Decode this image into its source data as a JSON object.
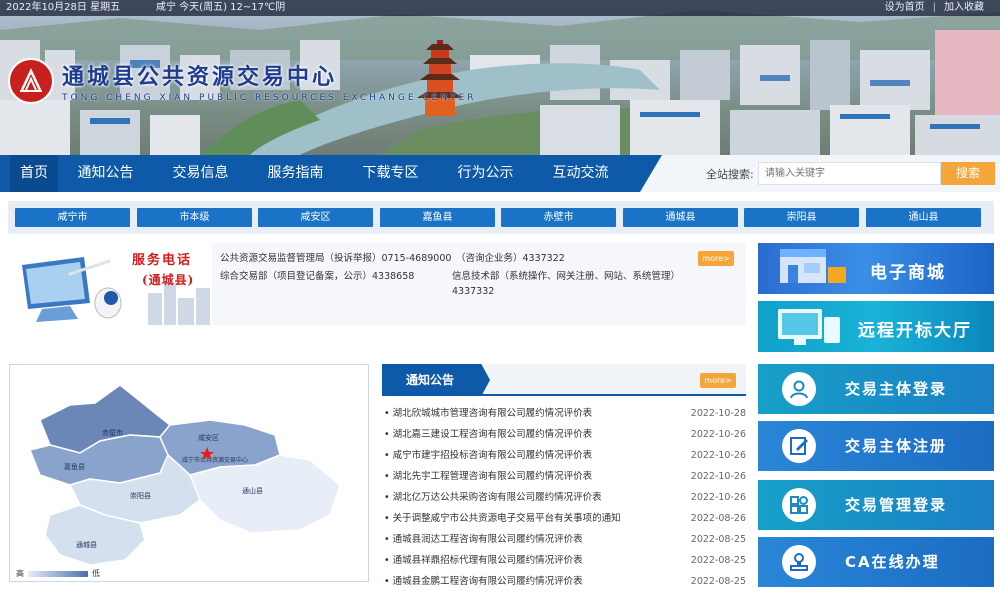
{
  "topbar": {
    "date": "2022年10月28日 星期五",
    "weather": "咸宁  今天(周五) 12~17℃阴",
    "set_home": "设为首页",
    "separator": "|",
    "add_fav": "加入收藏"
  },
  "logo": {
    "cn": "通城县公共资源交易中心",
    "en": "TONG CHENG XIAN PUBLIC RESOURCES EXCHANGE CENTER"
  },
  "nav": {
    "items": [
      "首页",
      "通知公告",
      "交易信息",
      "服务指南",
      "下载专区",
      "行为公示",
      "互动交流"
    ],
    "search_label": "全站搜索:",
    "search_placeholder": "请输入关键字",
    "search_button": "搜索"
  },
  "counties": [
    "咸宁市",
    "市本级",
    "咸安区",
    "嘉鱼县",
    "赤壁市",
    "通城县",
    "崇阳县",
    "通山县"
  ],
  "hotline": {
    "title": "服务电话",
    "subtitle": "(通城县)",
    "lines": [
      "公共资源交易监督管理局（投诉举报）0715-4689000",
      "（咨询企业务）4337322",
      "综合交易部（项目登记备案，公示）4338658",
      "信息技术部（系统操作、网关注册、网站、系统管理）",
      "4337332"
    ],
    "more": "more>"
  },
  "map": {
    "legend_high": "高",
    "legend_low": "低",
    "labels": {
      "chibi": "赤壁市",
      "xianan": "咸安区",
      "jiayu": "嘉鱼县",
      "chongyang": "崇阳县",
      "tongshan": "通山县",
      "tongcheng": "通城县",
      "center": "咸宁市公共资源交易中心"
    },
    "region_colors": {
      "dark": "#6b87b8",
      "mid": "#8aa3cc",
      "light": "#b9cbe4",
      "lighter": "#d5e0ef",
      "pale": "#e8eef7",
      "marker": "#e02020"
    }
  },
  "notices": {
    "title": "通知公告",
    "more": "more>",
    "items": [
      {
        "title": "湖北欣城城市管理咨询有限公司履约情况评价表",
        "date": "2022-10-28"
      },
      {
        "title": "湖北嘉三建设工程咨询有限公司履约情况评价表",
        "date": "2022-10-26"
      },
      {
        "title": "咸宁市建宇招投标咨询有限公司履约情况评价表",
        "date": "2022-10-26"
      },
      {
        "title": "湖北先宇工程管理咨询有限公司履约情况评价表",
        "date": "2022-10-26"
      },
      {
        "title": "湖北亿万达公共采购咨询有限公司履约情况评价表",
        "date": "2022-10-26"
      },
      {
        "title": "关于调整咸宁市公共资源电子交易平台有关事项的通知",
        "date": "2022-08-26"
      },
      {
        "title": "通城县润达工程咨询有限公司履约情况评价表",
        "date": "2022-08-25"
      },
      {
        "title": "通城县祥鼎招标代理有限公司履约情况评价表",
        "date": "2022-08-25"
      },
      {
        "title": "通城县金鹏工程咨询有限公司履约情况评价表",
        "date": "2022-08-25"
      }
    ]
  },
  "right": {
    "ecommerce": "电子商城",
    "remote_hall": "远程开标大厅",
    "services": [
      "交易主体登录",
      "交易主体注册",
      "交易管理登录",
      "CA在线办理"
    ]
  }
}
